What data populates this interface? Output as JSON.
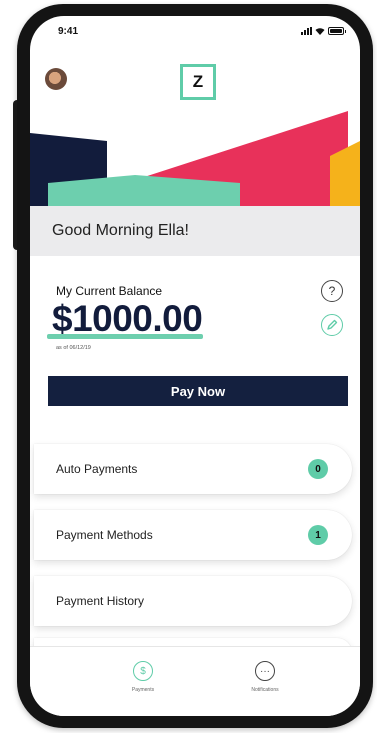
{
  "status_bar": {
    "time": "9:41"
  },
  "header": {
    "logo_letter": "Z"
  },
  "greeting": "Good Morning Ella!",
  "balance": {
    "label": "My Current Balance",
    "amount": "$1000.00",
    "as_of": "as of 06/12/19",
    "help_glyph": "?"
  },
  "pay_button": "Pay Now",
  "menu": [
    {
      "label": "Auto Payments",
      "badge": "0"
    },
    {
      "label": "Payment Methods",
      "badge": "1"
    },
    {
      "label": "Payment History"
    }
  ],
  "tabs": [
    {
      "label": "Payments",
      "glyph": "$",
      "icon": "dollar-icon"
    },
    {
      "label": "Notifications",
      "glyph": "···",
      "icon": "chat-icon"
    }
  ],
  "colors": {
    "accent": "#5fcca8",
    "navy": "#14203f",
    "banner_red": "#e8315a",
    "banner_yellow": "#f5b21b",
    "banner_dark": "#121c3c",
    "banner_mint": "#6dcfae"
  }
}
